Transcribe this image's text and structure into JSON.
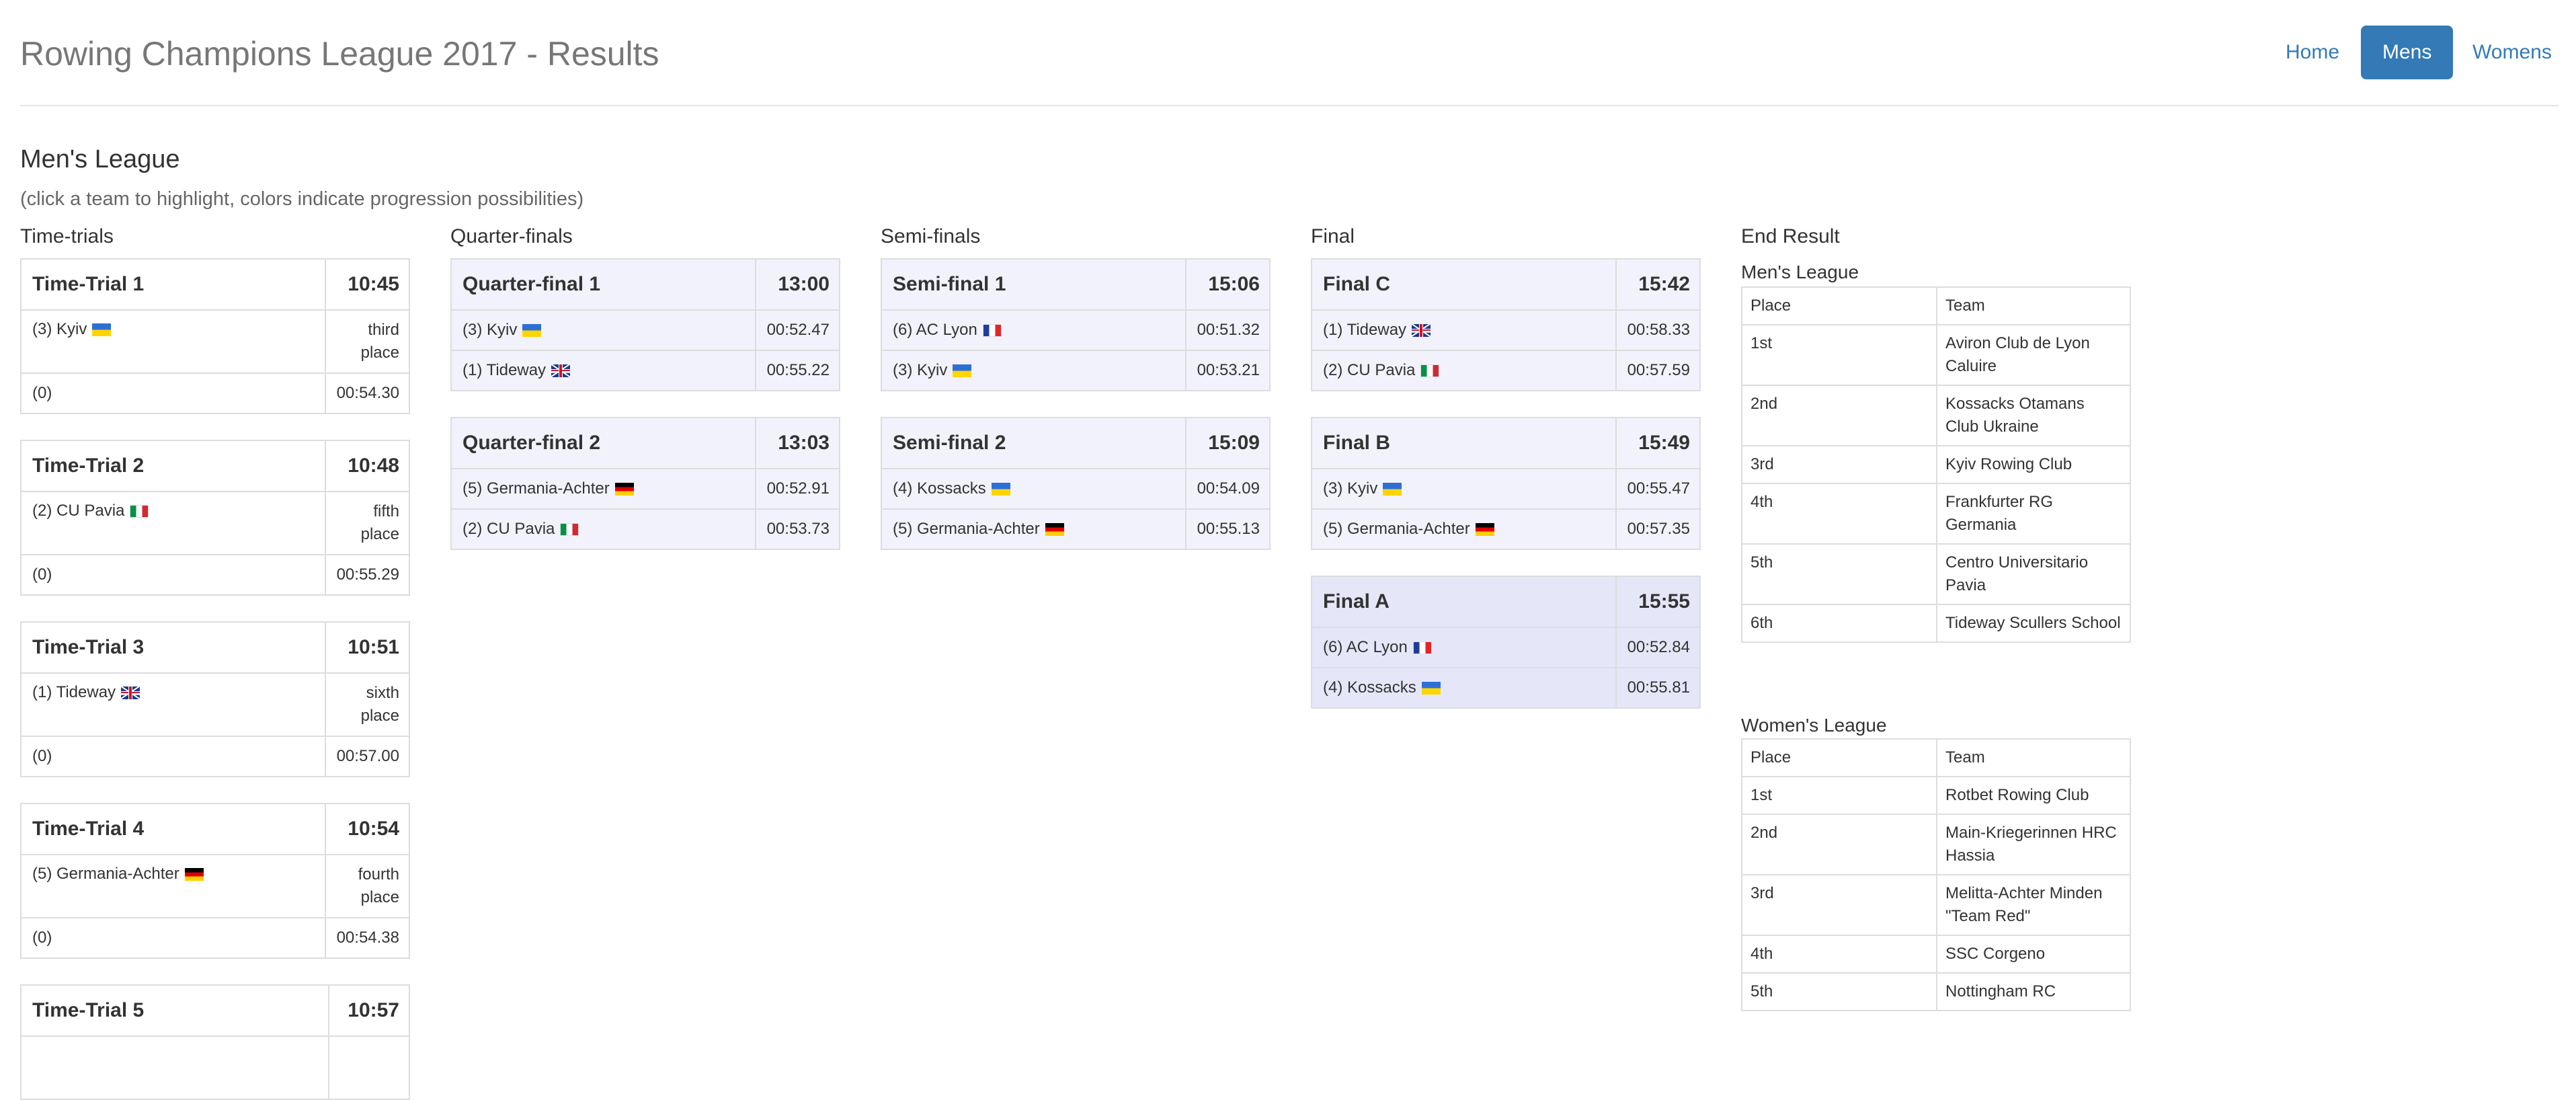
{
  "header": {
    "title": "Rowing Champions League 2017 - Results",
    "nav": [
      {
        "label": "Home",
        "active": false
      },
      {
        "label": "Mens",
        "active": true
      },
      {
        "label": "Womens",
        "active": false
      }
    ]
  },
  "league": {
    "heading": "Men's League",
    "instructions": "(click a team to highlight, colors indicate progression possibilities)"
  },
  "columns": {
    "time_trials": "Time-trials",
    "quarter_finals": "Quarter-finals",
    "semi_finals": "Semi-finals",
    "final": "Final",
    "end_result": "End Result"
  },
  "time_trials": [
    {
      "name": "Time-Trial 1",
      "time": "10:45",
      "team": "(3) Kyiv",
      "flag": "ua",
      "place": "third place",
      "other": "(0)",
      "result": "00:54.30"
    },
    {
      "name": "Time-Trial 2",
      "time": "10:48",
      "team": "(2) CU Pavia",
      "flag": "it",
      "place": "fifth place",
      "other": "(0)",
      "result": "00:55.29"
    },
    {
      "name": "Time-Trial 3",
      "time": "10:51",
      "team": "(1) Tideway",
      "flag": "gb",
      "place": "sixth place",
      "other": "(0)",
      "result": "00:57.00"
    },
    {
      "name": "Time-Trial 4",
      "time": "10:54",
      "team": "(5) Germania-Achter",
      "flag": "de",
      "place": "fourth place",
      "other": "(0)",
      "result": "00:54.38"
    },
    {
      "name": "Time-Trial 5",
      "time": "10:57"
    }
  ],
  "quarter_finals": [
    {
      "name": "Quarter-final 1",
      "time": "13:00",
      "rows": [
        {
          "team": "(3) Kyiv",
          "flag": "ua",
          "result": "00:52.47"
        },
        {
          "team": "(1) Tideway",
          "flag": "gb",
          "result": "00:55.22"
        }
      ]
    },
    {
      "name": "Quarter-final 2",
      "time": "13:03",
      "rows": [
        {
          "team": "(5) Germania-Achter",
          "flag": "de",
          "result": "00:52.91"
        },
        {
          "team": "(2) CU Pavia",
          "flag": "it",
          "result": "00:53.73"
        }
      ]
    }
  ],
  "semi_finals": [
    {
      "name": "Semi-final 1",
      "time": "15:06",
      "rows": [
        {
          "team": "(6) AC Lyon",
          "flag": "fr",
          "result": "00:51.32"
        },
        {
          "team": "(3) Kyiv",
          "flag": "ua",
          "result": "00:53.21"
        }
      ]
    },
    {
      "name": "Semi-final 2",
      "time": "15:09",
      "rows": [
        {
          "team": "(4) Kossacks",
          "flag": "ua",
          "result": "00:54.09"
        },
        {
          "team": "(5) Germania-Achter",
          "flag": "de",
          "result": "00:55.13"
        }
      ]
    }
  ],
  "finals": [
    {
      "name": "Final C",
      "time": "15:42",
      "rows": [
        {
          "team": "(1) Tideway",
          "flag": "gb",
          "result": "00:58.33"
        },
        {
          "team": "(2) CU Pavia",
          "flag": "it",
          "result": "00:57.59"
        }
      ]
    },
    {
      "name": "Final B",
      "time": "15:49",
      "rows": [
        {
          "team": "(3) Kyiv",
          "flag": "ua",
          "result": "00:55.47"
        },
        {
          "team": "(5) Germania-Achter",
          "flag": "de",
          "result": "00:57.35"
        }
      ]
    },
    {
      "name": "Final A",
      "time": "15:55",
      "rows": [
        {
          "team": "(6) AC Lyon",
          "flag": "fr",
          "result": "00:52.84"
        },
        {
          "team": "(4) Kossacks",
          "flag": "ua",
          "result": "00:55.81"
        }
      ]
    }
  ],
  "end_result": {
    "mens": {
      "heading": "Men's League",
      "header": {
        "place": "Place",
        "team": "Team"
      },
      "rows": [
        {
          "place": "1st",
          "team": "Aviron Club de Lyon Caluire"
        },
        {
          "place": "2nd",
          "team": "Kossacks Otamans Club Ukraine"
        },
        {
          "place": "3rd",
          "team": "Kyiv Rowing Club"
        },
        {
          "place": "4th",
          "team": "Frankfurter RG Germania"
        },
        {
          "place": "5th",
          "team": "Centro Universitario Pavia"
        },
        {
          "place": "6th",
          "team": "Tideway Scullers School"
        }
      ]
    },
    "womens": {
      "heading": "Women's League",
      "header": {
        "place": "Place",
        "team": "Team"
      },
      "rows": [
        {
          "place": "1st",
          "team": "Rotbet Rowing Club"
        },
        {
          "place": "2nd",
          "team": "Main-Kriegerinnen HRC Hassia"
        },
        {
          "place": "3rd",
          "team": "Melitta-Achter Minden \"Team Red\""
        },
        {
          "place": "4th",
          "team": "SSC Corgeno"
        },
        {
          "place": "5th",
          "team": "Nottingham RC"
        }
      ]
    }
  },
  "colors": {
    "accent": "#337ab7",
    "title_gray": "#777777",
    "highlight_light": "#f2f2fd",
    "highlight_final_a": "#e6e6f9",
    "border": "#dddddd"
  }
}
